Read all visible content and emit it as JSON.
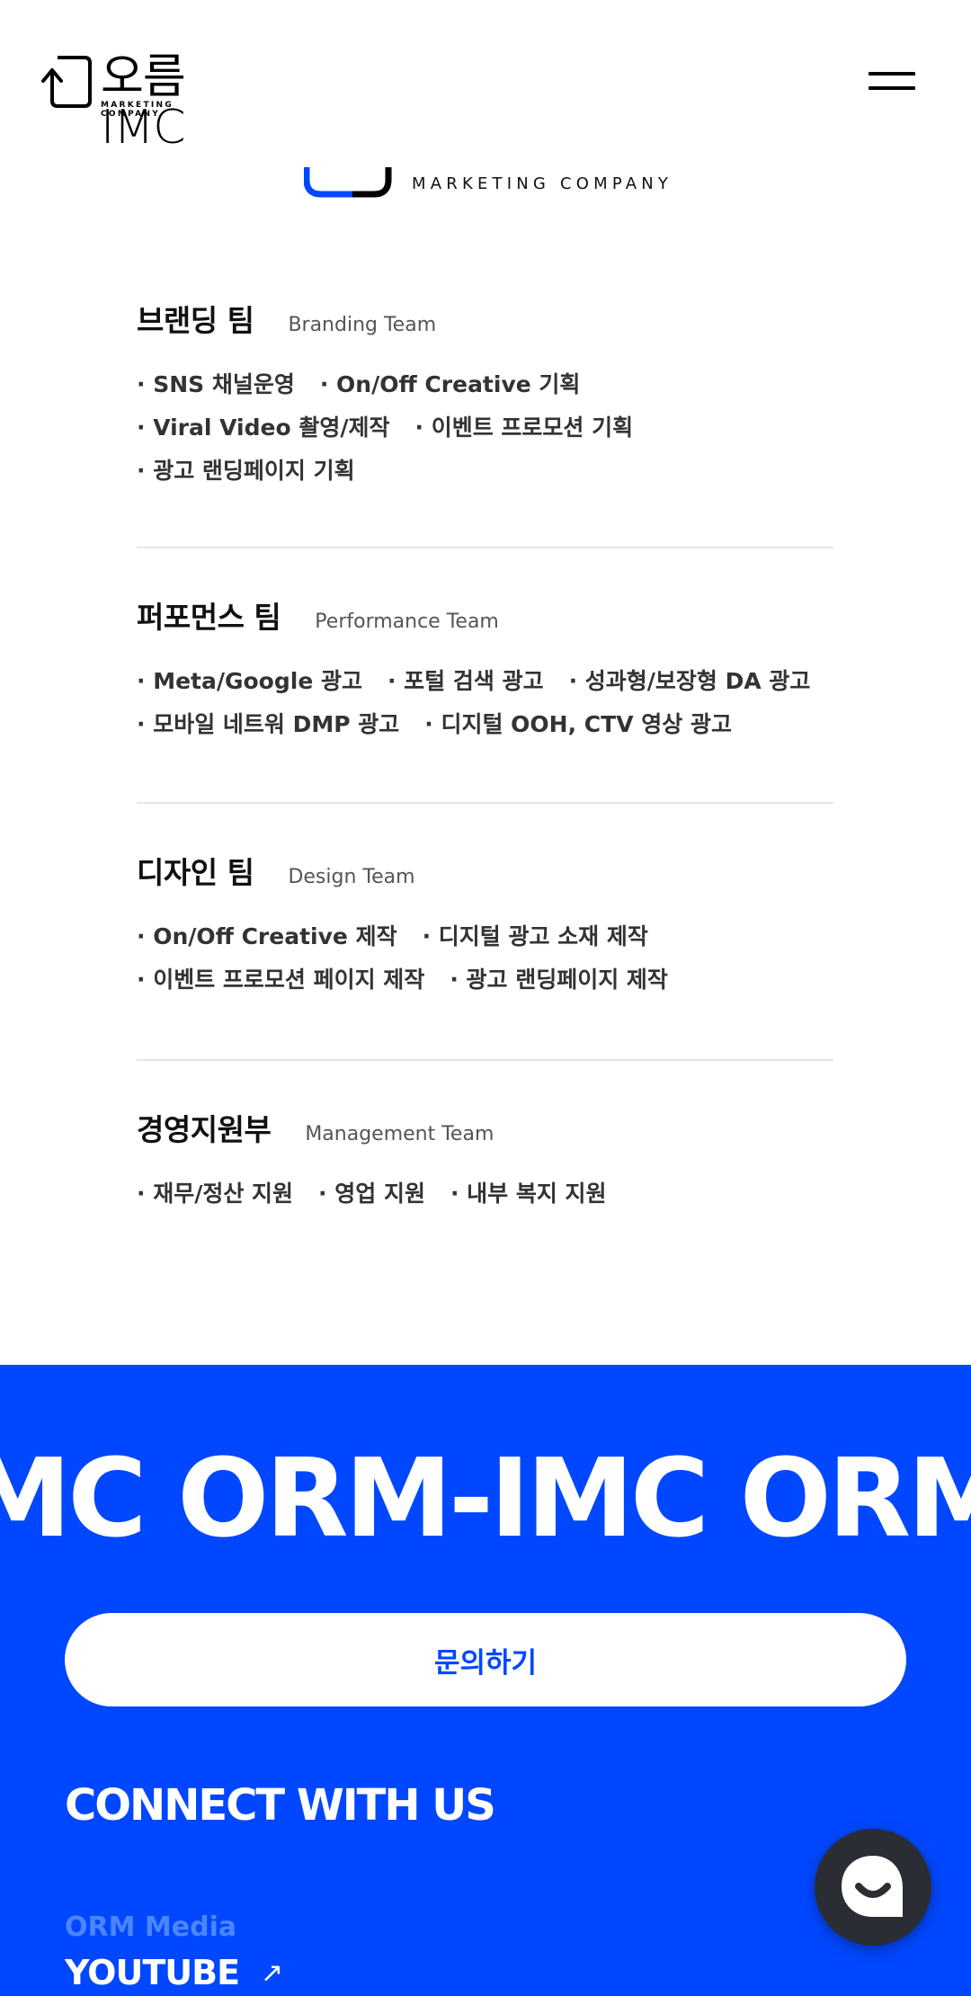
{
  "header": {
    "logo_text": "오름IMC",
    "logo_sub": "MARKETING COMPANY"
  },
  "hero": {
    "sub_text": "MARKETING COMPANY"
  },
  "teams": [
    {
      "title": "브랜딩 팀",
      "en": "Branding Team",
      "lines": [
        [
          "· SNS 채널운영",
          "· On/Off Creative 기획"
        ],
        [
          "· Viral Video 촬영/제작",
          "· 이벤트 프로모션 기획"
        ],
        [
          "· 광고 랜딩페이지 기획"
        ]
      ]
    },
    {
      "title": "퍼포먼스 팀",
      "en": "Performance Team",
      "lines": [
        [
          "· Meta/Google 광고",
          "· 포털 검색 광고",
          "· 성과형/보장형 DA 광고"
        ],
        [
          "· 모바일 네트워 DMP 광고",
          "· 디지털 OOH, CTV 영상 광고"
        ]
      ]
    },
    {
      "title": "디자인 팀",
      "en": "Design Team",
      "lines": [
        [
          "· On/Off Creative 제작",
          "· 디지털 광고 소재 제작"
        ],
        [
          "· 이벤트 프로모션 페이지 제작",
          "· 광고 랜딩페이지 제작"
        ]
      ]
    },
    {
      "title": "경영지원부",
      "en": "Management Team",
      "lines": [
        [
          "· 재무/정산 지원",
          "· 영업 지원",
          "· 내부 복지 지원"
        ]
      ]
    }
  ],
  "footer": {
    "marquee": "MC ORM-IMC ORM-",
    "contact_label": "문의하기",
    "connect_title": "CONNECT WITH US",
    "media_label": "ORM Media",
    "youtube_label": "YOUTUBE",
    "youtube_arrow": "↗"
  },
  "colors": {
    "brand_blue": "#0047ff",
    "chat_bg": "#2a2d33"
  },
  "icons": {
    "menu": "hamburger-icon",
    "chat": "chat-bubble-icon",
    "arrow": "arrow-up-right-icon"
  }
}
